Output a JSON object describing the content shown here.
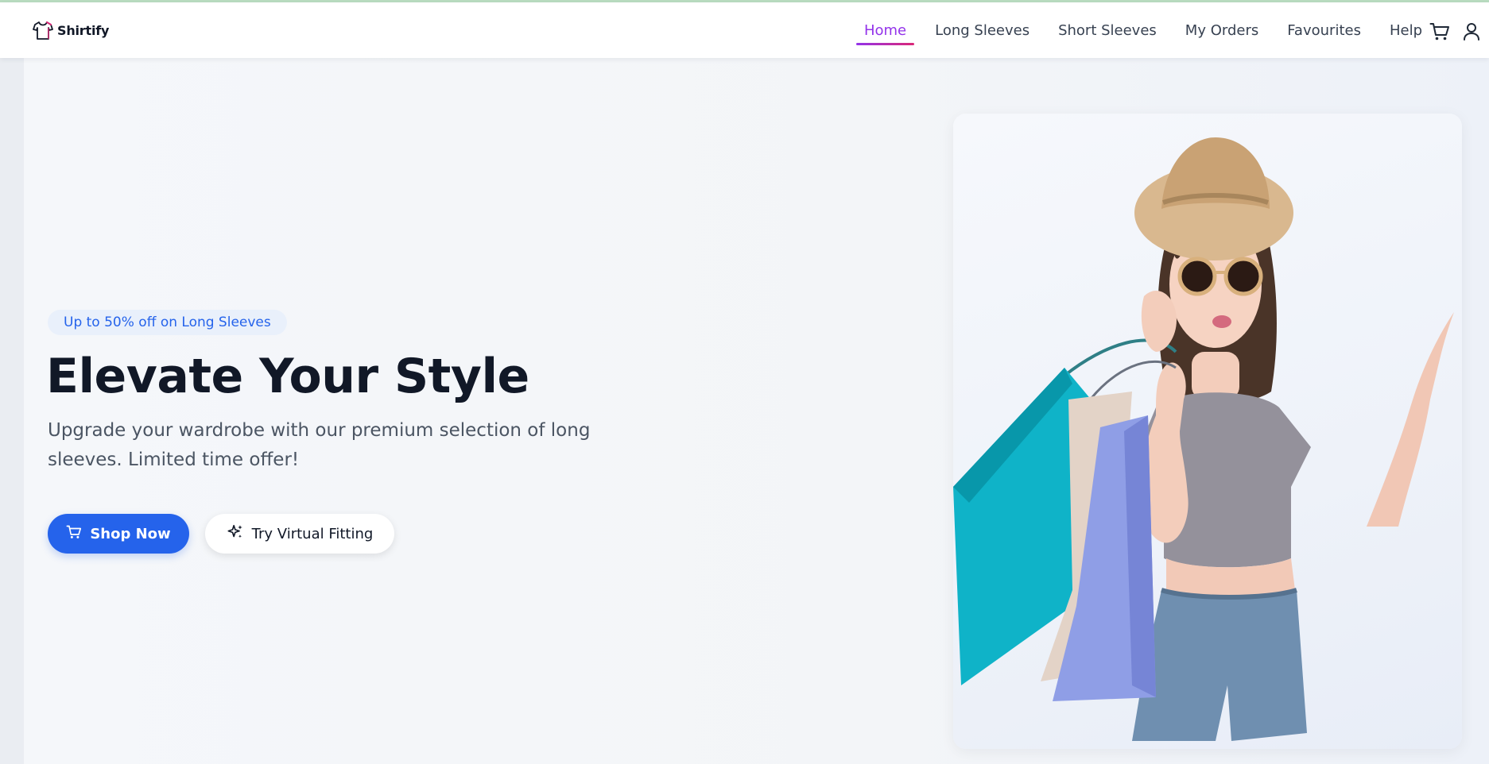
{
  "brand": {
    "name": "Shirtify",
    "logo_icon": "tshirt-logo-icon"
  },
  "nav": {
    "links": [
      {
        "label": "Home",
        "active": true
      },
      {
        "label": "Long Sleeves",
        "active": false
      },
      {
        "label": "Short Sleeves",
        "active": false
      },
      {
        "label": "My Orders",
        "active": false
      },
      {
        "label": "Favourites",
        "active": false
      },
      {
        "label": "Help",
        "active": false
      }
    ],
    "icons": [
      "cart-icon",
      "user-icon"
    ]
  },
  "hero": {
    "badge": "Up to 50% off on Long Sleeves",
    "headline": "Elevate Your Style",
    "subtext": "Upgrade your wardrobe with our premium selection of long sleeves. Limited time offer!",
    "primary_button": {
      "label": "Shop Now",
      "icon": "cart-icon"
    },
    "secondary_button": {
      "label": "Try Virtual Fitting",
      "icon": "sparkles-icon"
    },
    "image": "woman-with-shopping-bags-photo"
  },
  "colors": {
    "accent": "#2563eb",
    "active_nav": "#9333ea",
    "active_underline_end": "#db2777",
    "headline": "#111827",
    "badge_bg": "#e9f0fb"
  }
}
